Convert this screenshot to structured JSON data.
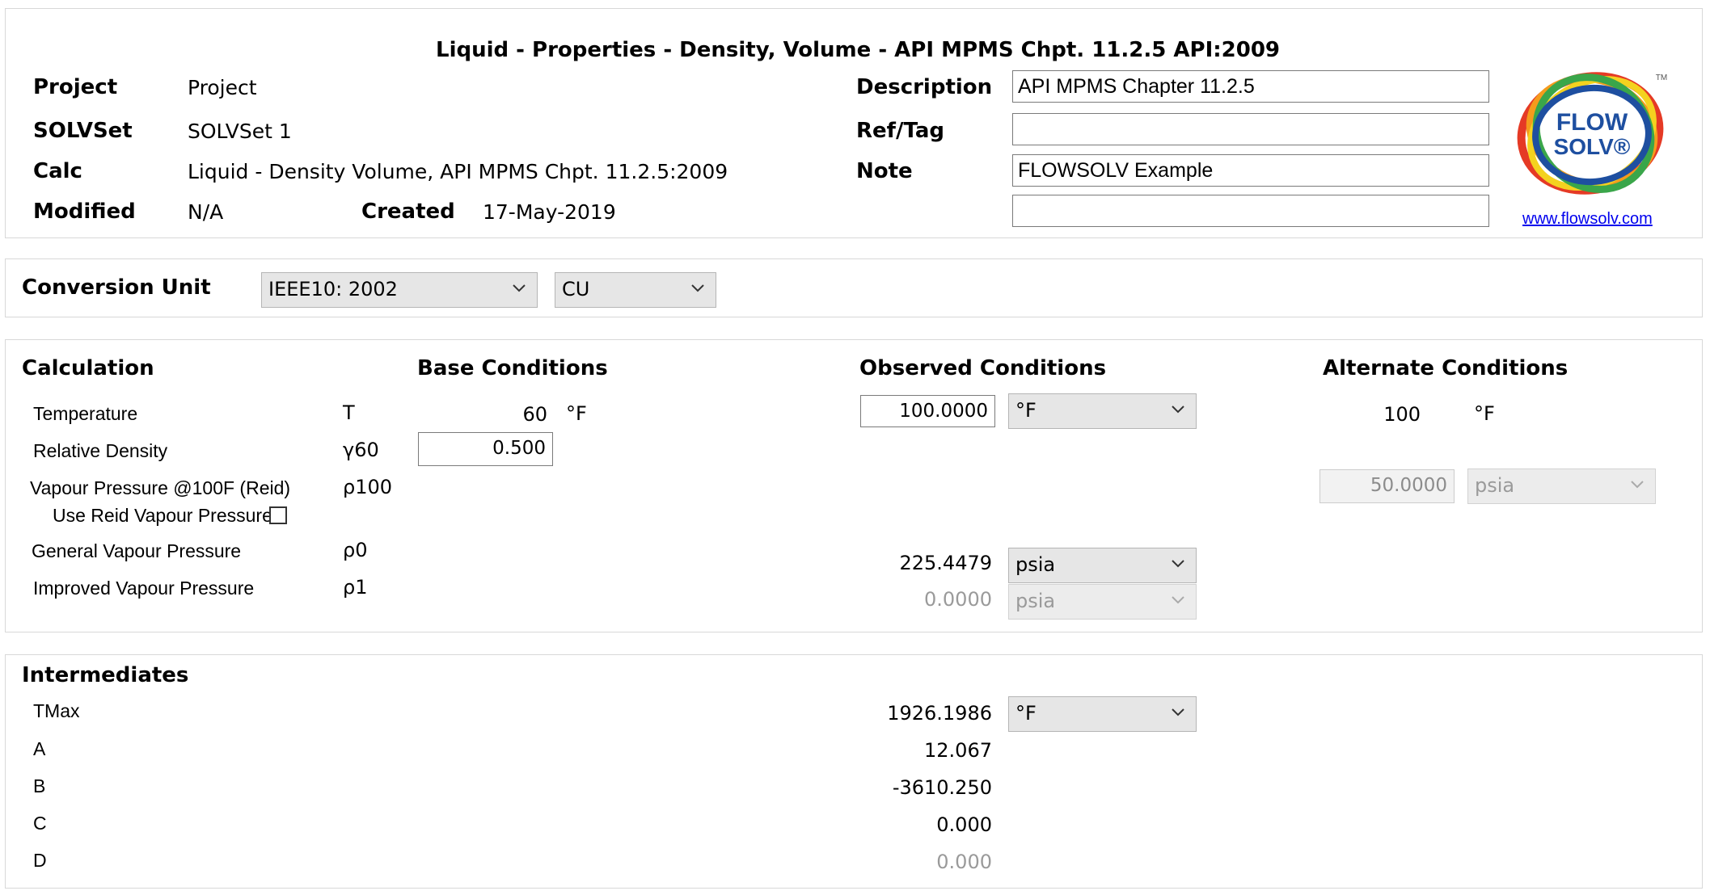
{
  "header": {
    "title": "Liquid - Properties - Density, Volume - API MPMS Chpt. 11.2.5 API:2009",
    "project_label": "Project",
    "project_value": "Project",
    "solvset_label": "SOLVSet",
    "solvset_value": "SOLVSet 1",
    "calc_label": "Calc",
    "calc_value": "Liquid - Density Volume, API MPMS Chpt. 11.2.5:2009",
    "modified_label": "Modified",
    "modified_value": "N/A",
    "created_label": "Created",
    "created_value": "17-May-2019",
    "description_label": "Description",
    "description_value": "API MPMS Chapter 11.2.5",
    "reftag_label": "Ref/Tag",
    "reftag_value": "",
    "note_label": "Note",
    "note_value": "FLOWSOLV Example",
    "extra_value": "",
    "logo_text_line1": "FLOW",
    "logo_text_line2": "SOLV®",
    "logo_tm": "TM",
    "website_link": "www.flowsolv.com"
  },
  "conversion": {
    "label": "Conversion Unit",
    "standard_selected": "IEEE10: 2002",
    "unit_system_selected": "CU"
  },
  "calculation": {
    "heading": "Calculation",
    "base_heading": "Base Conditions",
    "observed_heading": "Observed Conditions",
    "alternate_heading": "Alternate Conditions",
    "rows": [
      {
        "label": "Temperature",
        "symbol": "T",
        "base_value": "60",
        "base_unit": "°F",
        "observed_value": "100.0000",
        "observed_unit": "°F",
        "alternate_value": "100",
        "alternate_unit": "°F"
      },
      {
        "label": "Relative Density",
        "symbol": "γ60",
        "base_value": "0.500"
      },
      {
        "label": "Vapour Pressure @100F (Reid)",
        "symbol": "ρ100",
        "alternate_value": "50.0000",
        "alternate_unit": "psia"
      },
      {
        "label": "Use Reid Vapour Pressure",
        "checked": false
      },
      {
        "label": "General Vapour Pressure",
        "symbol": "ρ0",
        "observed_value": "225.4479",
        "observed_unit": "psia"
      },
      {
        "label": "Improved Vapour Pressure",
        "symbol": "ρ1",
        "observed_value": "0.0000",
        "observed_unit": "psia"
      }
    ]
  },
  "intermediates": {
    "heading": "Intermediates",
    "rows": [
      {
        "label": "TMax",
        "value": "1926.1986",
        "unit": "°F"
      },
      {
        "label": "A",
        "value": "12.067"
      },
      {
        "label": "B",
        "value": "-3610.250"
      },
      {
        "label": "C",
        "value": "0.000"
      },
      {
        "label": "D",
        "value": "0.000"
      }
    ]
  },
  "colors": {
    "logo_red": "#e53a25",
    "logo_orange": "#f59b1c",
    "logo_yellow": "#f4d21f",
    "logo_green": "#3aa64a",
    "logo_blue": "#1e4fa0",
    "link": "#0000ee",
    "disabled_text": "#8c8c8c"
  }
}
